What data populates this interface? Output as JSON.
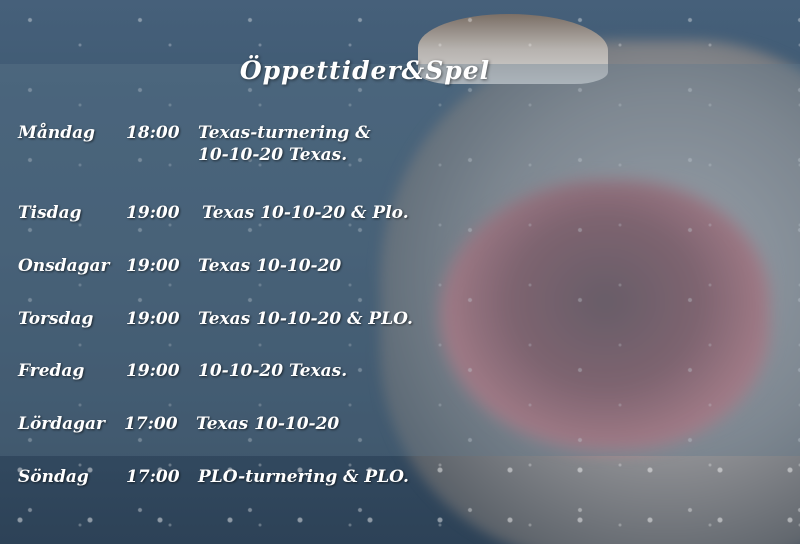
{
  "page": {
    "title": "Öppettider&Spel"
  },
  "schedule": [
    {
      "day": "Måndag",
      "time": "18:00",
      "game": "Texas-turnering &",
      "game_line2": "10-10-20 Texas."
    },
    {
      "day": "Tisdag",
      "time": "19:00",
      "game": "Texas 10-10-20  & Plo."
    },
    {
      "day": "Onsdagar",
      "time": "19:00",
      "game": "Texas 10-10-20"
    },
    {
      "day": "Torsdag",
      "time": "19:00",
      "game": "Texas 10-10-20  & PLO."
    },
    {
      "day": "Fredag",
      "time": "19:00",
      "game": "10-10-20 Texas."
    },
    {
      "day": "Lördagar",
      "time": "17:00",
      "game": "Texas 10-10-20"
    },
    {
      "day": "Söndag",
      "time": "17:00",
      "game": "PLO-turnering & PLO."
    }
  ],
  "colors": {
    "text": "#ffffff",
    "overlay": "#5f788c"
  },
  "background": {
    "icon": "shark-photo"
  }
}
